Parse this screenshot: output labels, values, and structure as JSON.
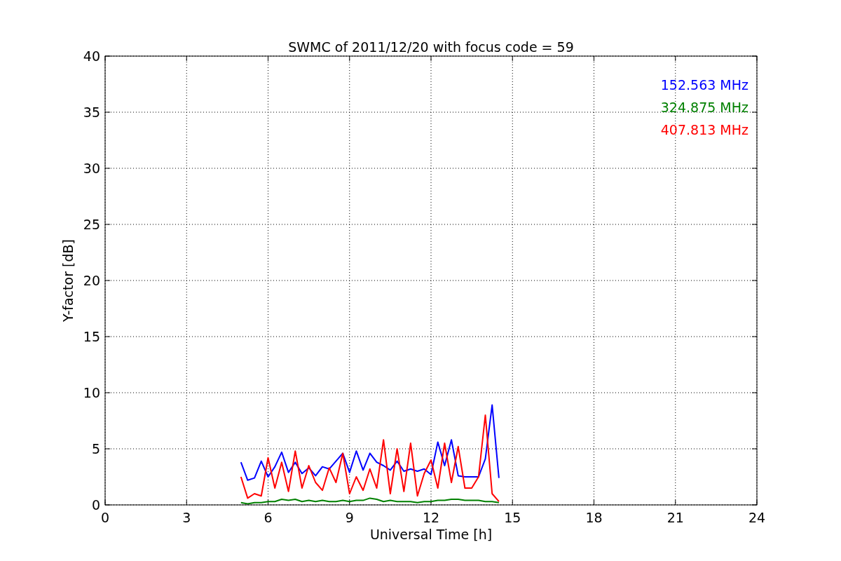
{
  "chart_data": {
    "type": "line",
    "title": "SWMC of 2011/12/20 with focus code = 59",
    "xlabel": "Universal Time [h]",
    "ylabel": "Y-factor [dB]",
    "x": [
      5,
      5.25,
      5.5,
      5.75,
      6,
      6.25,
      6.5,
      6.75,
      7,
      7.25,
      7.5,
      7.75,
      8,
      8.25,
      8.5,
      8.75,
      9,
      9.25,
      9.5,
      9.75,
      10,
      10.25,
      10.5,
      10.75,
      11,
      11.25,
      11.5,
      11.75,
      12,
      12.25,
      12.5,
      12.75,
      13,
      13.25,
      13.5,
      13.75,
      14,
      14.25,
      14.5
    ],
    "series": [
      {
        "name": "152.563 MHz",
        "color": "#0000ff",
        "values": [
          3.8,
          2.2,
          2.4,
          3.9,
          2.5,
          3.4,
          4.7,
          2.9,
          3.8,
          2.8,
          3.3,
          2.6,
          3.4,
          3.2,
          3.9,
          4.6,
          2.9,
          4.8,
          3.1,
          4.6,
          3.8,
          3.5,
          3.1,
          3.9,
          3.0,
          3.2,
          3.0,
          3.2,
          2.7,
          5.6,
          3.5,
          5.8,
          2.6,
          2.5,
          2.5,
          2.5,
          4.1,
          8.9,
          2.4
        ]
      },
      {
        "name": "324.875 MHz",
        "color": "#008000",
        "values": [
          0.2,
          0.1,
          0.2,
          0.2,
          0.3,
          0.3,
          0.5,
          0.4,
          0.5,
          0.3,
          0.4,
          0.3,
          0.4,
          0.3,
          0.3,
          0.4,
          0.3,
          0.4,
          0.4,
          0.6,
          0.5,
          0.3,
          0.4,
          0.3,
          0.3,
          0.3,
          0.2,
          0.3,
          0.3,
          0.4,
          0.4,
          0.5,
          0.5,
          0.4,
          0.4,
          0.4,
          0.3,
          0.3,
          0.2
        ]
      },
      {
        "name": "407.813 MHz",
        "color": "#ff0000",
        "values": [
          2.5,
          0.6,
          1.0,
          0.8,
          4.2,
          1.5,
          3.8,
          1.2,
          4.8,
          1.5,
          3.5,
          2.0,
          1.3,
          3.3,
          2.0,
          4.6,
          1.0,
          2.5,
          1.3,
          3.2,
          1.5,
          5.8,
          1.0,
          5.0,
          1.2,
          5.5,
          0.8,
          2.8,
          4.0,
          1.5,
          5.5,
          2.0,
          5.2,
          1.5,
          1.5,
          2.5,
          8.0,
          1.0,
          0.3
        ]
      }
    ],
    "grid": true,
    "xlim": [
      0,
      24
    ],
    "ylim": [
      0,
      40
    ],
    "xticks": [
      0,
      3,
      6,
      9,
      12,
      15,
      18,
      21,
      24
    ],
    "yticks": [
      0,
      5,
      10,
      15,
      20,
      25,
      30,
      35,
      40
    ]
  }
}
